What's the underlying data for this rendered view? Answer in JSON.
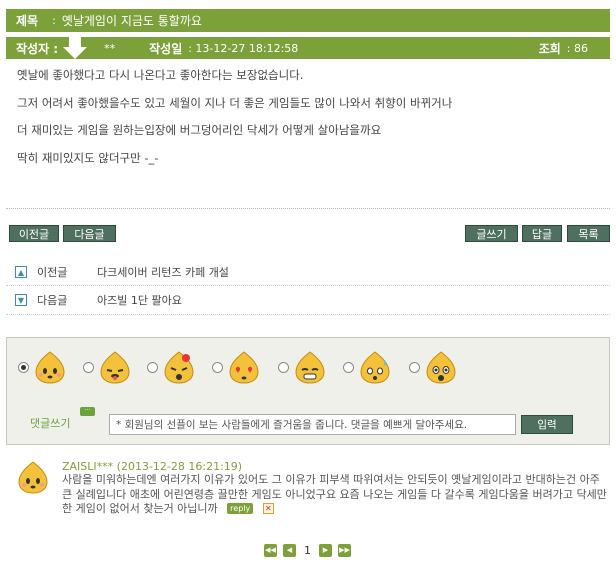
{
  "post": {
    "title_label": "제목",
    "title_value": "옛날게임이 지금도 통할까요",
    "author_label": "작성자 :",
    "author_value": "**",
    "date_label": "작성일",
    "date_value": ": 13-12-27 18:12:58",
    "views_label": "조회",
    "views_value": ": 86",
    "body": [
      "옛날에 좋아했다고 다시 나온다고 좋아한다는 보장없습니다.",
      "그저 어려서 좋아했을수도 있고 세월이 지나 더 좋은 게임들도 많이 나와서 취향이 바뀌거나",
      "더 재미있는 게임을 원하는입장에 버그덩어리인 닥세가 어떻게 살아남을까요",
      "딱히 재미있지도 않더구만 -_-"
    ]
  },
  "buttons": {
    "prev": "이전글",
    "next": "다음글",
    "write": "글쓰기",
    "reply": "답글",
    "list": "목록"
  },
  "nav": {
    "prev_label": "이전글",
    "prev_title": "다크세이버 리턴즈 카페 개설",
    "next_label": "다음글",
    "next_title": "아즈빌 1단 팔아요"
  },
  "comment_form": {
    "label": "댓글쓰기",
    "placeholder": "* 회원님의 선플이 보는 사람들에게 즐거움을 줍니다. 댓글을 예쁘게 달아주세요.",
    "submit": "입력",
    "emoticons": [
      "smile-face",
      "tongue-face",
      "angry-face",
      "love-face",
      "grin-face",
      "sweat-face",
      "shock-face"
    ],
    "selected_emoticon": 0
  },
  "comments": [
    {
      "author": "ZAISLI***",
      "date": "(2013-12-28 16:21:19)",
      "text": "사람을 미워하는데엔 여러가지 이유가 있어도 그 이유가 피부색 따위여서는 안되듯이 옛날게임이라고 반대하는건 아주 큰 실례입니다 애초에 어린연령층 끌만한 게임도 아니었구요 요즘 나오는 게임들 다 갈수록 게임다움을 버려가고 닥세만한 게임이 없어서 찾는거 아닙니까",
      "reply_label": "reply"
    }
  ],
  "pager": {
    "current": "1"
  },
  "colors": {
    "header_green": "#7da13a",
    "button_dark": "#4f6f5f",
    "nav_blue": "#3a8fb0"
  }
}
